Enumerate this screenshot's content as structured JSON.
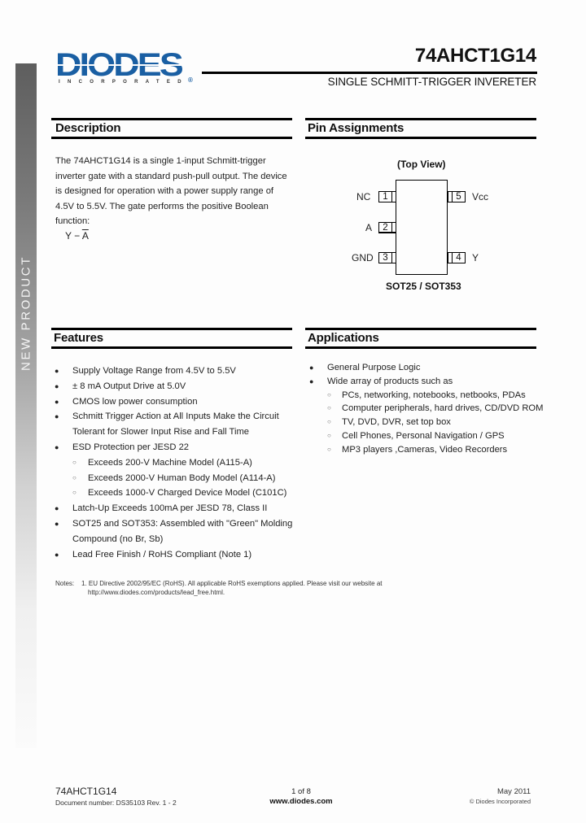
{
  "sidebar": {
    "label": "NEW PRODUCT"
  },
  "logo": {
    "brand": "DIODES",
    "tagline": "INCORPORATED",
    "registered": "®",
    "brand_color": "#1a5fa3"
  },
  "header": {
    "part_number": "74AHCT1G14",
    "subtitle": "SINGLE SCHMITT-TRIGGER INVERETER"
  },
  "description": {
    "title": "Description",
    "paragraph": "The 74AHCT1G14 is a single 1-input Schmitt-trigger inverter gate with a standard push-pull output. The device is designed for operation with a power supply range of 4.5V to 5.5V. The gate performs the positive Boolean function:",
    "function_lhs": "Y − ",
    "function_rhs": "A"
  },
  "pin_assignments": {
    "title": "Pin Assignments",
    "view_label": "(Top View)",
    "package_label": "SOT25 / SOT353",
    "pins": [
      {
        "number": "1",
        "name": "NC"
      },
      {
        "number": "2",
        "name": "A"
      },
      {
        "number": "3",
        "name": "GND"
      },
      {
        "number": "4",
        "name": "Y"
      },
      {
        "number": "5",
        "name": "Vcc"
      }
    ]
  },
  "features": {
    "title": "Features",
    "items": [
      {
        "text": "Supply Voltage Range from 4.5V  to 5.5V",
        "level": 1
      },
      {
        "text": "± 8 mA Output Drive at 5.0V",
        "level": 1
      },
      {
        "text": "CMOS low power consumption",
        "level": 1
      },
      {
        "text": "Schmitt Trigger Action at All Inputs Make the Circuit Tolerant for Slower Input Rise and Fall Time",
        "level": 1
      },
      {
        "text": "ESD Protection per JESD 22",
        "level": 1
      },
      {
        "text": "Exceeds 200-V Machine Model (A115-A)",
        "level": 2
      },
      {
        "text": "Exceeds 2000-V Human Body Model (A114-A)",
        "level": 2
      },
      {
        "text": "Exceeds 1000-V Charged Device Model (C101C)",
        "level": 2
      },
      {
        "text": "Latch-Up Exceeds 100mA per JESD 78, Class II",
        "level": 1
      },
      {
        "text": "SOT25 and SOT353: Assembled with \"Green\" Molding Compound (no Br, Sb)",
        "level": 1
      },
      {
        "text": "Lead Free Finish / RoHS Compliant (Note 1)",
        "level": 1
      }
    ]
  },
  "applications": {
    "title": "Applications",
    "items": [
      {
        "text": "General Purpose Logic",
        "level": 1
      },
      {
        "text": "Wide array of products such as",
        "level": 1
      },
      {
        "text": "PCs, networking, notebooks, netbooks, PDAs",
        "level": 2
      },
      {
        "text": "Computer peripherals, hard drives, CD/DVD ROM",
        "level": 2
      },
      {
        "text": "TV, DVD, DVR, set top box",
        "level": 2
      },
      {
        "text": "Cell Phones, Personal Navigation / GPS",
        "level": 2
      },
      {
        "text": "MP3 players ,Cameras, Video Recorders",
        "level": 2
      }
    ]
  },
  "notes": {
    "label": "Notes:",
    "line1": "1. EU Directive 2002/95/EC (RoHS). All applicable RoHS exemptions applied. Please visit our website at",
    "line2": "http://www.diodes.com/products/lead_free.html."
  },
  "footer": {
    "part_number": "74AHCT1G14",
    "document_number": "Document number: DS35103 Rev. 1 - 2",
    "page": "1 of 8",
    "website": "www.diodes.com",
    "date": "May 2011",
    "copyright": "© Diodes Incorporated"
  }
}
